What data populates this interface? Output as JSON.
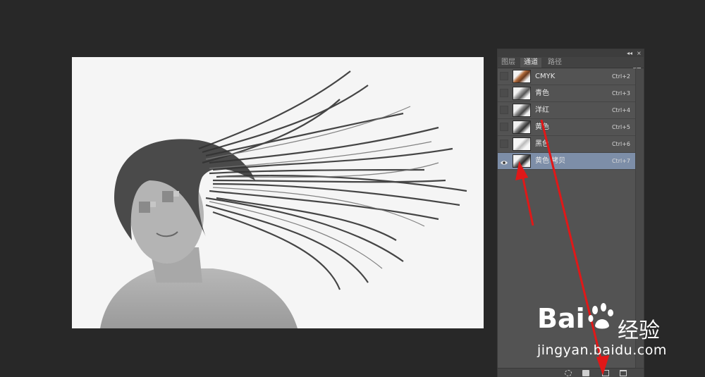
{
  "panel": {
    "collapse_label": "◂◂",
    "close_label": "×",
    "menu_label": "▾≡",
    "tabs": [
      {
        "label": "图层",
        "active": false
      },
      {
        "label": "通道",
        "active": true
      },
      {
        "label": "路径",
        "active": false
      }
    ],
    "channels": [
      {
        "name": "CMYK",
        "shortcut": "Ctrl+2",
        "visible": false,
        "selected": false
      },
      {
        "name": "青色",
        "shortcut": "Ctrl+3",
        "visible": false,
        "selected": false
      },
      {
        "name": "洋红",
        "shortcut": "Ctrl+4",
        "visible": false,
        "selected": false
      },
      {
        "name": "黄色",
        "shortcut": "Ctrl+5",
        "visible": false,
        "selected": false
      },
      {
        "name": "黑色",
        "shortcut": "Ctrl+6",
        "visible": false,
        "selected": false
      },
      {
        "name": "黄色 拷贝",
        "shortcut": "Ctrl+7",
        "visible": true,
        "selected": true
      }
    ]
  },
  "watermark": {
    "brand": "Bai",
    "brand_cn": "经验",
    "url": "jingyan.baidu.com"
  },
  "colors": {
    "background": "#282828",
    "panel": "#535353",
    "selected_row": "#7d8ea8",
    "arrow": "#e01818"
  }
}
